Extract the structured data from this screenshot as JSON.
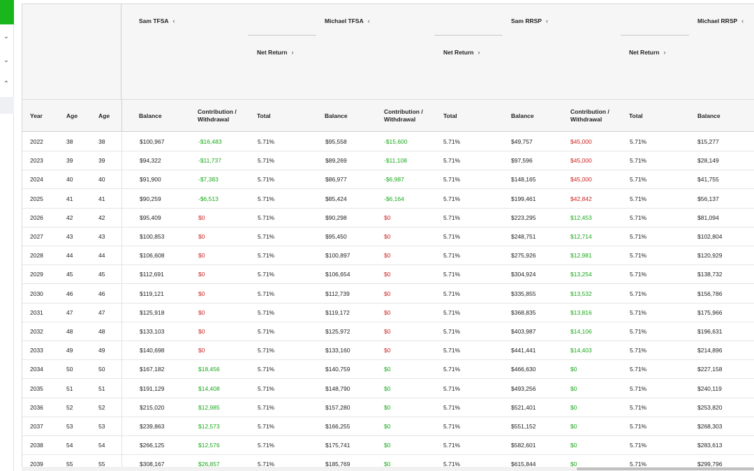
{
  "groups": [
    {
      "label": "Sam TFSA",
      "sub": ""
    },
    {
      "label": "Michael TFSA",
      "sub": "Net Return"
    },
    {
      "label": "Sam RRSP",
      "sub": "Net Return"
    },
    {
      "label": "Michael RRSP",
      "sub": "Net Return"
    }
  ],
  "columns": [
    "Year",
    "Age",
    "Age",
    "Balance",
    "Contribution /\nWithdrawal",
    "Total",
    "Balance",
    "Contribution /\nWithdrawal",
    "Total",
    "Balance",
    "Contribution /\nWithdrawal",
    "Total",
    "Balance"
  ],
  "rows": [
    [
      "2022",
      "38",
      "38",
      "$100,967",
      "-$16,483",
      "5.71%",
      "$95,558",
      "-$15,600",
      "5.71%",
      "$49,757",
      "$45,000",
      "5.71%",
      "$15,277"
    ],
    [
      "2023",
      "39",
      "39",
      "$94,322",
      "-$11,737",
      "5.71%",
      "$89,269",
      "-$11,108",
      "5.71%",
      "$97,596",
      "$45,000",
      "5.71%",
      "$28,149"
    ],
    [
      "2024",
      "40",
      "40",
      "$91,900",
      "-$7,383",
      "5.71%",
      "$86,977",
      "-$6,987",
      "5.71%",
      "$148,165",
      "$45,000",
      "5.71%",
      "$41,755"
    ],
    [
      "2025",
      "41",
      "41",
      "$90,259",
      "-$6,513",
      "5.71%",
      "$85,424",
      "-$6,164",
      "5.71%",
      "$199,461",
      "$42,842",
      "5.71%",
      "$56,137"
    ],
    [
      "2026",
      "42",
      "42",
      "$95,409",
      "$0",
      "5.71%",
      "$90,298",
      "$0",
      "5.71%",
      "$223,295",
      "$12,453",
      "5.71%",
      "$81,094"
    ],
    [
      "2027",
      "43",
      "43",
      "$100,853",
      "$0",
      "5.71%",
      "$95,450",
      "$0",
      "5.71%",
      "$248,751",
      "$12,714",
      "5.71%",
      "$102,804"
    ],
    [
      "2028",
      "44",
      "44",
      "$106,608",
      "$0",
      "5.71%",
      "$100,897",
      "$0",
      "5.71%",
      "$275,926",
      "$12,981",
      "5.71%",
      "$120,929"
    ],
    [
      "2029",
      "45",
      "45",
      "$112,691",
      "$0",
      "5.71%",
      "$106,654",
      "$0",
      "5.71%",
      "$304,924",
      "$13,254",
      "5.71%",
      "$138,732"
    ],
    [
      "2030",
      "46",
      "46",
      "$119,121",
      "$0",
      "5.71%",
      "$112,739",
      "$0",
      "5.71%",
      "$335,855",
      "$13,532",
      "5.71%",
      "$156,786"
    ],
    [
      "2031",
      "47",
      "47",
      "$125,918",
      "$0",
      "5.71%",
      "$119,172",
      "$0",
      "5.71%",
      "$368,835",
      "$13,816",
      "5.71%",
      "$175,966"
    ],
    [
      "2032",
      "48",
      "48",
      "$133,103",
      "$0",
      "5.71%",
      "$125,972",
      "$0",
      "5.71%",
      "$403,987",
      "$14,106",
      "5.71%",
      "$196,631"
    ],
    [
      "2033",
      "49",
      "49",
      "$140,698",
      "$0",
      "5.71%",
      "$133,160",
      "$0",
      "5.71%",
      "$441,441",
      "$14,403",
      "5.71%",
      "$214,896"
    ],
    [
      "2034",
      "50",
      "50",
      "$167,182",
      "$18,456",
      "5.71%",
      "$140,759",
      "$0",
      "5.71%",
      "$466,630",
      "$0",
      "5.71%",
      "$227,158"
    ],
    [
      "2035",
      "51",
      "51",
      "$191,129",
      "$14,408",
      "5.71%",
      "$148,790",
      "$0",
      "5.71%",
      "$493,256",
      "$0",
      "5.71%",
      "$240,119"
    ],
    [
      "2036",
      "52",
      "52",
      "$215,020",
      "$12,985",
      "5.71%",
      "$157,280",
      "$0",
      "5.71%",
      "$521,401",
      "$0",
      "5.71%",
      "$253,820"
    ],
    [
      "2037",
      "53",
      "53",
      "$239,863",
      "$12,573",
      "5.71%",
      "$166,255",
      "$0",
      "5.71%",
      "$551,152",
      "$0",
      "5.71%",
      "$268,303"
    ],
    [
      "2038",
      "54",
      "54",
      "$266,125",
      "$12,576",
      "5.71%",
      "$175,741",
      "$0",
      "5.71%",
      "$582,601",
      "$0",
      "5.71%",
      "$283,613"
    ],
    [
      "2039",
      "55",
      "55",
      "$308,167",
      "$26,857",
      "5.71%",
      "$185,769",
      "$0",
      "5.71%",
      "$615,844",
      "$0",
      "5.71%",
      "$299,796"
    ]
  ],
  "row_colors": [
    [
      "neg",
      "neg",
      "red"
    ],
    [
      "neg",
      "neg",
      "red"
    ],
    [
      "neg",
      "neg",
      "red"
    ],
    [
      "neg",
      "neg",
      "red"
    ],
    [
      "red",
      "red",
      "grn"
    ],
    [
      "red",
      "red",
      "grn"
    ],
    [
      "red",
      "red",
      "grn"
    ],
    [
      "red",
      "red",
      "grn"
    ],
    [
      "red",
      "red",
      "grn"
    ],
    [
      "red",
      "red",
      "grn"
    ],
    [
      "red",
      "red",
      "grn"
    ],
    [
      "red",
      "red",
      "grn"
    ],
    [
      "grn",
      "grn",
      "grn"
    ],
    [
      "grn",
      "grn",
      "grn"
    ],
    [
      "grn",
      "grn",
      "grn"
    ],
    [
      "grn",
      "grn",
      "grn"
    ],
    [
      "grn",
      "grn",
      "grn"
    ],
    [
      "grn",
      "grn",
      "grn"
    ]
  ],
  "colors": {
    "green": "#1aa81a",
    "red": "#cc2222",
    "brand": "#19b71b"
  }
}
